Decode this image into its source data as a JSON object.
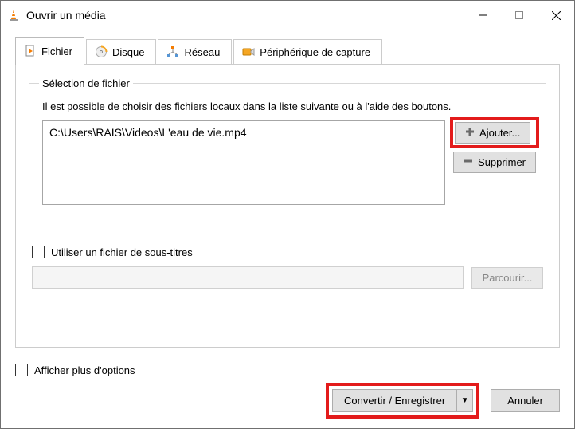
{
  "title": "Ouvrir un média",
  "tabs": {
    "file": "Fichier",
    "disc": "Disque",
    "network": "Réseau",
    "capture": "Périphérique de capture"
  },
  "fileSelection": {
    "legend": "Sélection de fichier",
    "hint": "Il est possible de choisir des fichiers locaux dans la liste suivante ou à l'aide des boutons.",
    "path": "C:\\Users\\RAIS\\Videos\\L'eau de vie.mp4",
    "addButton": "Ajouter...",
    "removeButton": "Supprimer"
  },
  "subtitle": {
    "checkboxLabel": "Utiliser un fichier de sous-titres",
    "browseButton": "Parcourir..."
  },
  "footer": {
    "moreOptions": "Afficher plus d'options",
    "convert": "Convertir / Enregistrer",
    "cancel": "Annuler"
  }
}
